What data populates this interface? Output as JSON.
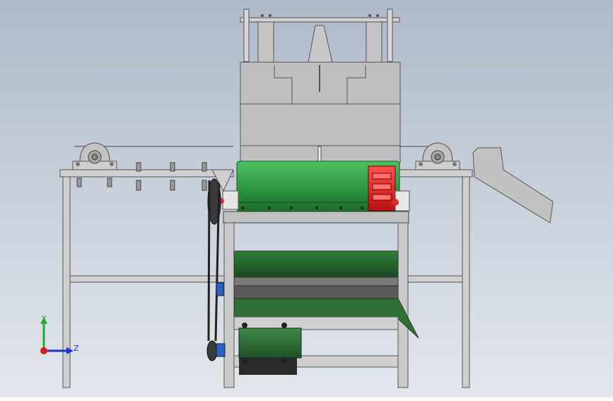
{
  "viewport": {
    "background_top": "#aebac9",
    "background_bottom": "#e3e7ed",
    "model_parts": {
      "frame_color": "#c8c8c8",
      "frame_dark": "#8e8e8e",
      "housing_color": "#bdbdbd",
      "drum_color": "#2f9b45",
      "drum_dark": "#1d6a2c",
      "drive_end_color": "#e02020",
      "pulley_color": "#3a3a3a",
      "motor_color": "#2d6e35",
      "bearing_blue": "#2a62c8"
    }
  },
  "triad": {
    "y_label": "Y",
    "z_label": "Z",
    "y_color": "#22aa33",
    "z_color": "#2233cc",
    "origin_color": "#cc2222"
  }
}
